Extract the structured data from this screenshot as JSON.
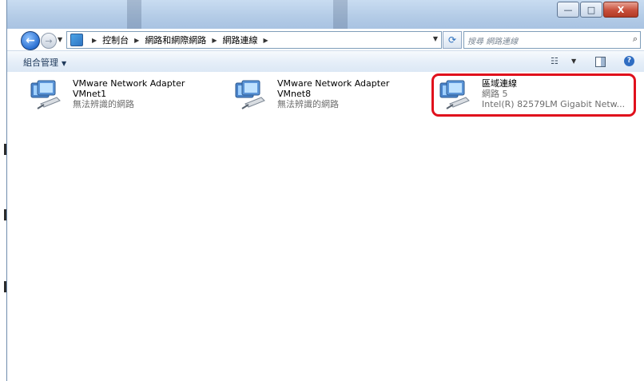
{
  "window": {
    "controls": {
      "minimize": "—",
      "maximize": "□",
      "close": "X"
    }
  },
  "navigation": {
    "back_icon": "back-arrow-icon",
    "forward_icon": "forward-arrow-icon",
    "breadcrumbs": [
      "控制台",
      "網路和網際網路",
      "網路連線"
    ],
    "refresh_icon": "refresh-icon",
    "search_placeholder": "搜尋 網路連線",
    "search_icon": "magnifier-icon"
  },
  "toolbar": {
    "organize_label": "組合管理",
    "view_icon": "change-view-icon",
    "preview_icon": "preview-pane-icon",
    "help_label": "?"
  },
  "connections": [
    {
      "name": "VMware Network Adapter",
      "line2": "VMnet1",
      "status": "無法辨識的網路",
      "icon": "network-adapter-icon"
    },
    {
      "name": "VMware Network Adapter",
      "line2": "VMnet8",
      "status": "無法辨識的網路",
      "icon": "network-adapter-icon"
    },
    {
      "name": "區域連線",
      "line2": "網路 5",
      "status": "Intel(R) 82579LM Gigabit Netw...",
      "icon": "network-adapter-icon"
    }
  ],
  "colors": {
    "highlight": "#e0101c",
    "status_text": "#6d6d6d",
    "toolbar_text": "#1e395b"
  }
}
